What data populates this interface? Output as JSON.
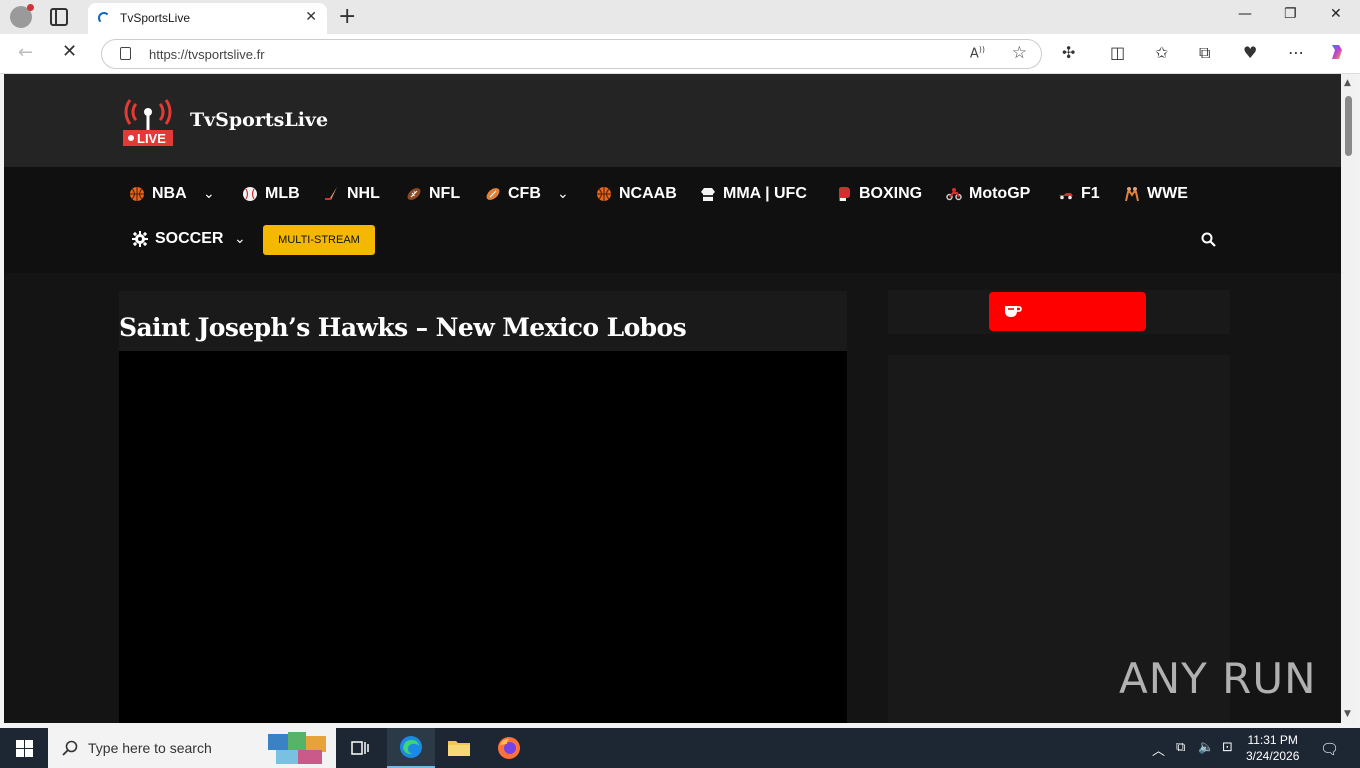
{
  "browser": {
    "tab_title": "TvSportsLive",
    "url": "https://tvsportslive.fr",
    "new_tab_glyph": "+",
    "close_tab_glyph": "✕",
    "window_controls": [
      "—",
      "❐",
      "✕"
    ]
  },
  "site": {
    "brand": "TvSportsLive",
    "logo_text": "LIVE",
    "nav": [
      {
        "label": "NBA",
        "icon": "basketball-icon",
        "has_dropdown": true
      },
      {
        "label": "MLB",
        "icon": "baseball-icon",
        "has_dropdown": false
      },
      {
        "label": "NHL",
        "icon": "hockey-stick-icon",
        "has_dropdown": false
      },
      {
        "label": "NFL",
        "icon": "football-icon",
        "has_dropdown": false
      },
      {
        "label": "CFB",
        "icon": "football-icon",
        "has_dropdown": true
      },
      {
        "label": "NCAAB",
        "icon": "basketball-icon",
        "has_dropdown": false
      },
      {
        "label": "MMA | UFC",
        "icon": "martial-arts-uniform-icon",
        "has_dropdown": false
      },
      {
        "label": "BOXING",
        "icon": "boxing-glove-icon",
        "has_dropdown": false
      },
      {
        "label": "MotoGP",
        "icon": "motorcycle-icon",
        "has_dropdown": false
      },
      {
        "label": "F1",
        "icon": "racing-car-icon",
        "has_dropdown": false
      },
      {
        "label": "WWE",
        "icon": "wrestling-icon",
        "has_dropdown": false
      },
      {
        "label": "SOCCER",
        "icon": "gear-icon",
        "has_dropdown": true
      }
    ],
    "multistream_label": "MULTI-STREAM",
    "post_title": "Saint Joseph’s Hawks – New Mexico Lobos",
    "watermark": "ANY RUN"
  },
  "colors": {
    "accent_yellow": "#f5b800",
    "live_red": "#ff0000",
    "page_bg": "#141414",
    "header_bg": "#242424"
  },
  "taskbar": {
    "search_placeholder": "Type here to search",
    "time": "11:31 PM",
    "date": "3/24/2026"
  }
}
